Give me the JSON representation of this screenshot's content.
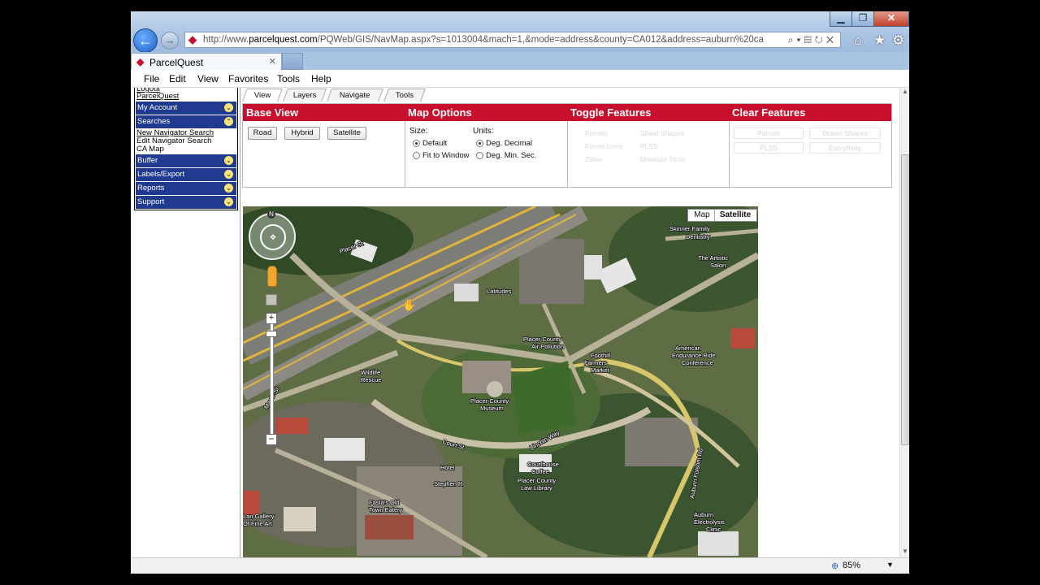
{
  "browser": {
    "url_prefix": "http://www.",
    "url_domain": "parcelquest.com",
    "url_rest": "/PQWeb/GIS/NavMap.aspx?s=1013004&mach=1,&mode=address&county=CA012&address=auburn%20ca",
    "tab_title": "ParcelQuest",
    "menu": [
      "File",
      "Edit",
      "View",
      "Favorites",
      "Tools",
      "Help"
    ],
    "zoom": "85%"
  },
  "sidebar": {
    "top_links": [
      "Logout",
      "ParcelQuest"
    ],
    "sections": [
      {
        "label": "My Account"
      },
      {
        "label": "Searches"
      },
      {
        "label": "Buffer"
      },
      {
        "label": "Labels/Export"
      },
      {
        "label": "Reports"
      },
      {
        "label": "Support"
      }
    ],
    "search_links": [
      "New Navigator Search",
      "Edit Navigator Search",
      "CA Map"
    ]
  },
  "tool_tabs": [
    "View",
    "Layers",
    "Navigate",
    "Tools"
  ],
  "panels": {
    "base_view": {
      "title": "Base View",
      "buttons": [
        "Road",
        "Hybrid",
        "Satellite"
      ]
    },
    "map_options": {
      "title": "Map Options",
      "size_label": "Size:",
      "units_label": "Units:",
      "size_options": [
        "Default",
        "Fit to Window"
      ],
      "units_options": [
        "Deg. Decimal",
        "Deg. Min. Sec."
      ]
    },
    "toggle_features": {
      "title": "Toggle Features",
      "items": [
        "Parcels",
        "Parcel Icons",
        "Zillow",
        "Street Shapes",
        "PLSS",
        "Measure Tools"
      ]
    },
    "clear_features": {
      "title": "Clear Features",
      "buttons": [
        "Parcels",
        "Drawn Shapes",
        "PLSS",
        "Everything"
      ]
    }
  },
  "map": {
    "type_buttons": [
      "Map",
      "Satellite"
    ],
    "compass": "N",
    "labels": [
      "Skinner Family Dentistry",
      "The Artistic Salon",
      "Placer County Air Pollution",
      "Foothill Farmers Market",
      "American Endurance Ride Conference",
      "Wildlife Rescue",
      "Placer County Museum",
      "Courthouse Coffee",
      "Placer County Law Library",
      "Auburn Electrolysis Clinic",
      "Auburn Folsom Rd",
      "Maple St",
      "Latitudes",
      "Court St",
      "Lincoln Way",
      "Placer St",
      "Hotel Stephen R"
    ]
  }
}
